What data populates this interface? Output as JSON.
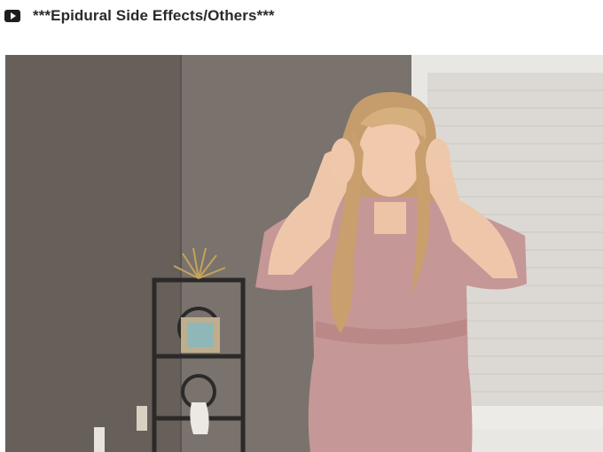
{
  "header": {
    "play_icon": "play-icon",
    "title": "***Epidural Side Effects/Others***"
  },
  "video": {
    "content": "video-frame",
    "colors": {
      "wall_left": "#6b6560",
      "wall_back": "#7a726d",
      "window_frame": "#e8e6e3",
      "blind": "#dedbd6",
      "dress": "#c79a98",
      "hair": "#c99f6e",
      "skin": "#f0c8ab",
      "shelf": "#2b2a29"
    }
  }
}
